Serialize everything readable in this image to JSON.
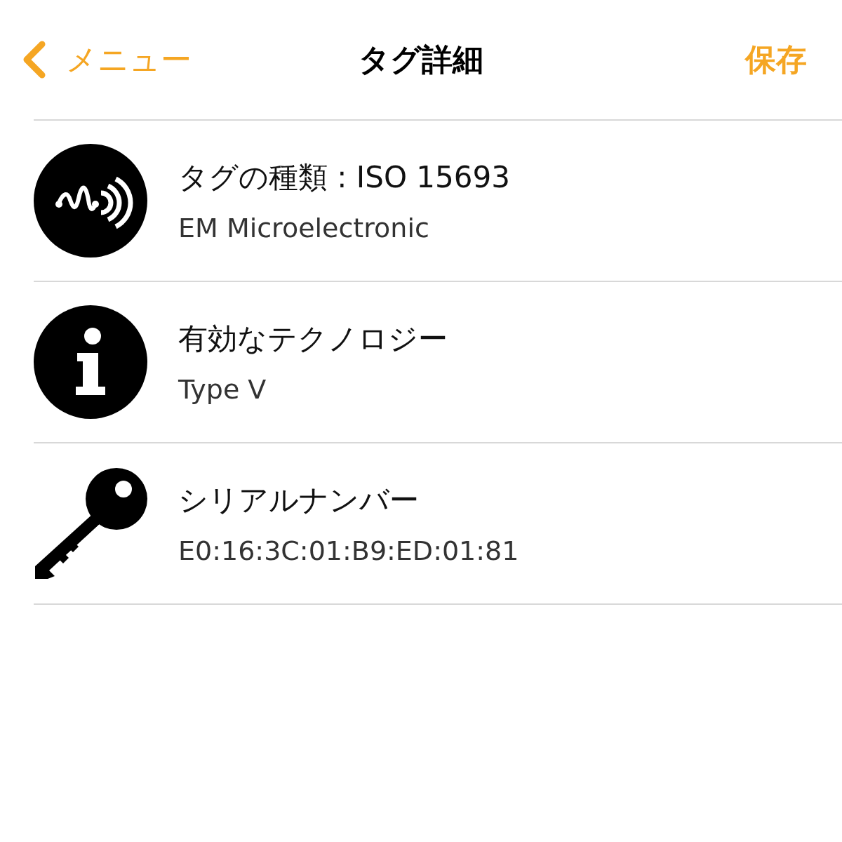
{
  "nav": {
    "back_label": "メニュー",
    "title": "タグ詳細",
    "action": "保存"
  },
  "rows": [
    {
      "kind": "nfc",
      "title": "タグの種類 : ISO 15693",
      "detail": "EM Microelectronic"
    },
    {
      "kind": "info",
      "title": "有効なテクノロジー",
      "detail": "Type V"
    },
    {
      "kind": "key",
      "title": "シリアルナンバー",
      "detail": "E0:16:3C:01:B9:ED:01:81"
    }
  ]
}
